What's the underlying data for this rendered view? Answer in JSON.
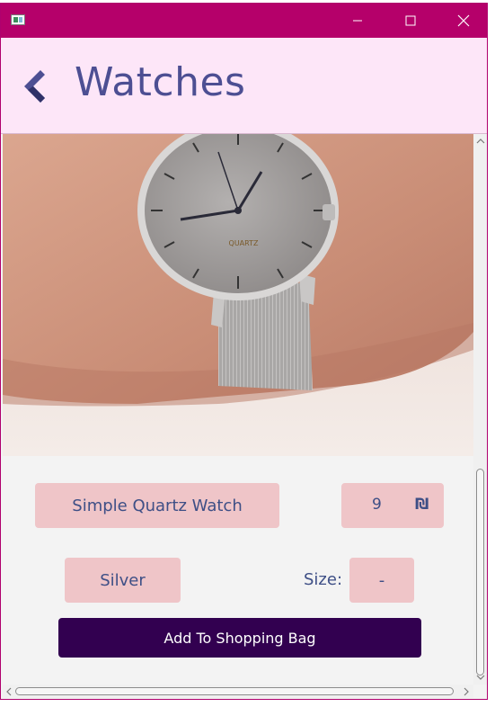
{
  "window": {
    "title": "",
    "controls": {
      "minimize": "minimize-icon",
      "maximize": "maximize-icon",
      "close": "close-icon"
    }
  },
  "header": {
    "title": "Watches",
    "back_icon": "chevron-left-icon"
  },
  "product": {
    "image_alt": "Silver mesh quartz watch on wrist",
    "dial_text": "QUARTZ",
    "name": "Simple Quartz Watch",
    "price": "9",
    "currency_symbol": "₪",
    "color": "Silver",
    "size_label": "Size:",
    "size_value": "-"
  },
  "actions": {
    "add_to_bag": "Add To Shopping Bag"
  },
  "colors": {
    "titlebar": "#b5006a",
    "header_bg": "#fde6f8",
    "title_text": "#4d4f93",
    "field_bg": "#efc5c8",
    "field_text": "#3e4f86",
    "button_bg": "#320050"
  }
}
